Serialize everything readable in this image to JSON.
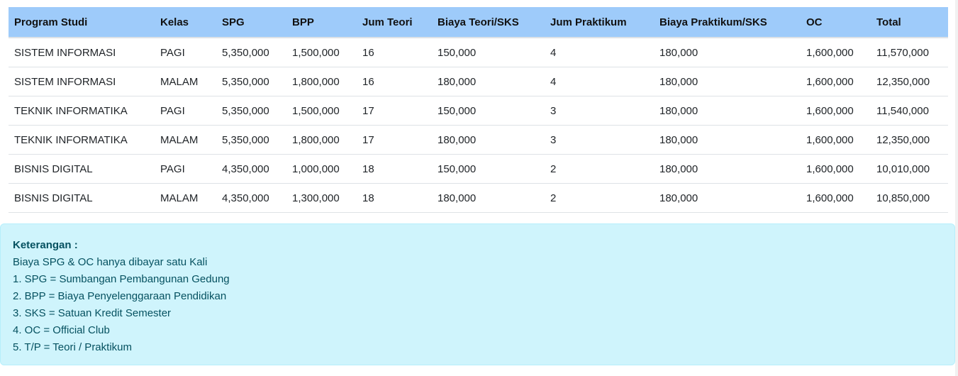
{
  "table": {
    "headers": [
      "Program Studi",
      "Kelas",
      "SPG",
      "BPP",
      "Jum Teori",
      "Biaya Teori/SKS",
      "Jum Praktikum",
      "Biaya Praktikum/SKS",
      "OC",
      "Total"
    ],
    "rows": [
      [
        "SISTEM INFORMASI",
        "PAGI",
        "5,350,000",
        "1,500,000",
        "16",
        "150,000",
        "4",
        "180,000",
        "1,600,000",
        "11,570,000"
      ],
      [
        "SISTEM INFORMASI",
        "MALAM",
        "5,350,000",
        "1,800,000",
        "16",
        "180,000",
        "4",
        "180,000",
        "1,600,000",
        "12,350,000"
      ],
      [
        "TEKNIK INFORMATIKA",
        "PAGI",
        "5,350,000",
        "1,500,000",
        "17",
        "150,000",
        "3",
        "180,000",
        "1,600,000",
        "11,540,000"
      ],
      [
        "TEKNIK INFORMATIKA",
        "MALAM",
        "5,350,000",
        "1,800,000",
        "17",
        "180,000",
        "3",
        "180,000",
        "1,600,000",
        "12,350,000"
      ],
      [
        "BISNIS DIGITAL",
        "PAGI",
        "4,350,000",
        "1,000,000",
        "18",
        "150,000",
        "2",
        "180,000",
        "1,600,000",
        "10,010,000"
      ],
      [
        "BISNIS DIGITAL",
        "MALAM",
        "4,350,000",
        "1,300,000",
        "18",
        "180,000",
        "2",
        "180,000",
        "1,600,000",
        "10,850,000"
      ]
    ],
    "header_color": "#9ecbfa"
  },
  "note": {
    "title": "Keterangan :",
    "lines": [
      "Biaya SPG & OC hanya dibayar satu Kali",
      "1. SPG = Sumbangan Pembangunan Gedung",
      "2. BPP = Biaya Penyelenggaraan Pendidikan",
      "3. SKS = Satuan Kredit Semester",
      "4. OC = Official Club",
      "5. T/P = Teori / Praktikum"
    ],
    "background_color": "#cff4fc",
    "text_color": "#055160"
  }
}
